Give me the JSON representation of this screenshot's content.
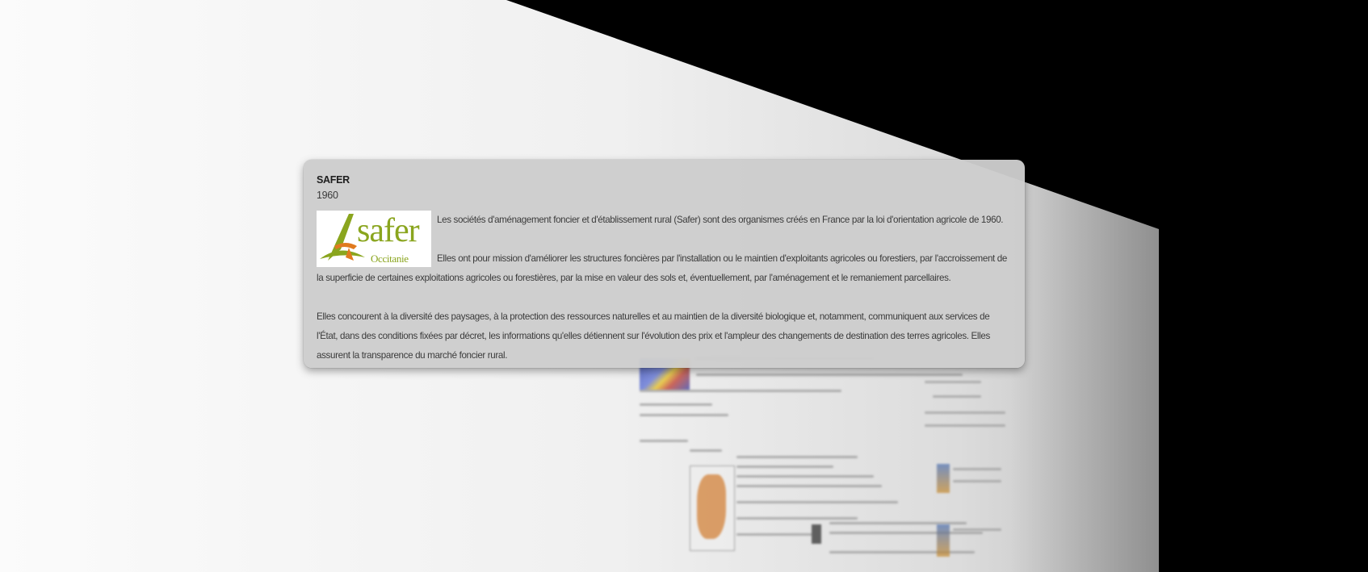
{
  "card": {
    "title": "SAFER",
    "year": "1960",
    "logo": {
      "name": "safer",
      "subtitle": "Occitanie",
      "colors": {
        "green": "#8aa51e",
        "orange": "#e07a1f"
      }
    },
    "paragraphs": [
      "Les sociétés d'aménagement foncier et d'établissement rural (Safer) sont des organismes créés en France par la loi d'orientation agricole de 1960.",
      "Elles ont pour mission d'améliorer les structures foncières par l'installation ou le maintien d'exploitants agricoles ou forestiers, par l'accroissement de la superficie de certaines exploitations agricoles ou forestières, par la mise en valeur des sols et, éventuellement, par l'aménagement et le remaniement parcellaires.",
      "Elles concourent à la diversité des paysages, à la protection des ressources naturelles et au maintien de la diversité biologique et, notamment, communiquent aux services de l'État, dans des conditions fixées par décret, les informations qu'elles détiennent sur l'évolution des prix et l'ampleur des changements de destination des terres agricoles. Elles assurent la transparence du marché foncier rural."
    ]
  }
}
